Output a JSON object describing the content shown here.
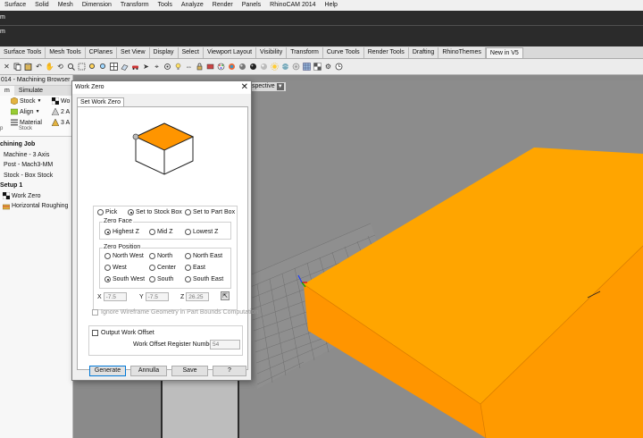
{
  "menubar": [
    "Surface",
    "Solid",
    "Mesh",
    "Dimension",
    "Transform",
    "Tools",
    "Analyze",
    "Render",
    "Panels",
    "RhinoCAM 2014",
    "Help"
  ],
  "cmd": {
    "line1": "m",
    "line2": "m"
  },
  "tabs": [
    "Surface Tools",
    "Mesh Tools",
    "CPlanes",
    "Set View",
    "Display",
    "Select",
    "Viewport Layout",
    "Visibility",
    "Transform",
    "Curve Tools",
    "Render Tools",
    "Drafting",
    "RhinoThemes",
    "New in V5"
  ],
  "left_panel": {
    "title": "014 - Machining Browser",
    "ribbon_tabs": [
      "m",
      "Simulate"
    ],
    "ribbon_buttons": {
      "stock": "Stock",
      "align": "Align",
      "material": "Material",
      "w": "Wo",
      "a2": "2 A",
      "a3": "3 A"
    },
    "groups": {
      "p": "p",
      "stock": "Stock"
    },
    "tree": [
      "chining Job",
      "Machine - 3 Axis",
      "Post - Mach3-MM",
      "Stock - Box Stock",
      "Setup 1",
      "Work Zero",
      "Horizontal Roughing"
    ]
  },
  "viewport": {
    "title": "spective",
    "dropdown_icon": "chevron-down-icon"
  },
  "dialog": {
    "title": "Work Zero",
    "close_icon": "close-icon",
    "tab": "Set Work Zero",
    "mode": {
      "options": [
        "Pick",
        "Set to Stock Box",
        "Set to Part Box"
      ],
      "selected": "Set to Stock Box"
    },
    "zero_face": {
      "label": "Zero Face",
      "options": [
        "Highest Z",
        "Mid Z",
        "Lowest Z"
      ],
      "selected": "Highest Z"
    },
    "zero_position": {
      "label": "Zero Position",
      "options": [
        "North West",
        "North",
        "North East",
        "West",
        "Center",
        "East",
        "South West",
        "South",
        "South East"
      ],
      "selected": "South West"
    },
    "coords": {
      "x_label": "X",
      "x": "-7.5",
      "y_label": "Y",
      "y": "-7.5",
      "z_label": "Z",
      "z": "26.25"
    },
    "ignore_wireframe": "Ignore Wireframe Geometry in Part Bounds Computation",
    "output_offset": "Output Work Offset",
    "register_label": "Work Offset Register Number:",
    "register_value": "54",
    "buttons": {
      "generate": "Generate",
      "annulla": "Annulla",
      "save": "Save",
      "help": "?"
    }
  },
  "colors": {
    "stock_orange": "#ff9f00",
    "viewport_gray": "#8c8c8c",
    "dialog_bg": "#f0f0f0",
    "selection_blue": "#0078d7"
  }
}
